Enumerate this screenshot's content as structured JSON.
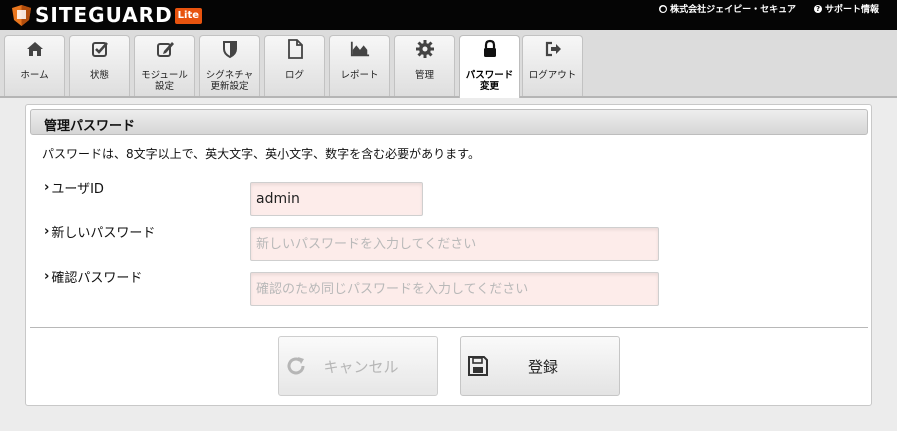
{
  "header": {
    "logo_text": "SITEGUARD",
    "logo_badge": "Lite",
    "links": [
      {
        "icon": "globe-icon",
        "label": "株式会社ジェイピー・セキュア"
      },
      {
        "icon": "question-icon",
        "label": "サポート情報"
      }
    ]
  },
  "tabs": [
    {
      "icon": "home-icon",
      "label": "ホーム",
      "active": false
    },
    {
      "icon": "checkbox-icon",
      "label": "状態",
      "active": false
    },
    {
      "icon": "edit-icon",
      "label": "モジュール\n設定",
      "active": false
    },
    {
      "icon": "shield-icon",
      "label": "シグネチャ\n更新設定",
      "active": false
    },
    {
      "icon": "file-icon",
      "label": "ログ",
      "active": false
    },
    {
      "icon": "area-chart-icon",
      "label": "レポート",
      "active": false
    },
    {
      "icon": "gear-icon",
      "label": "管理",
      "active": false
    },
    {
      "icon": "lock-icon",
      "label": "パスワード\n変更",
      "active": true
    },
    {
      "icon": "logout-icon",
      "label": "ログアウト",
      "active": false
    }
  ],
  "panel": {
    "title": "管理パスワード",
    "description": "パスワードは、8文字以上で、英大文字、英小文字、数字を含む必要があります。",
    "fields": {
      "user_id": {
        "label": "ユーザID",
        "value": "admin"
      },
      "new_password": {
        "label": "新しいパスワード",
        "value": "",
        "placeholder": "新しいパスワードを入力してください"
      },
      "confirm_password": {
        "label": "確認パスワード",
        "value": "",
        "placeholder": "確認のため同じパスワードを入力してください"
      }
    },
    "buttons": {
      "cancel": "キャンセル",
      "save": "登録"
    }
  },
  "colors": {
    "header_bg": "#050505",
    "lite_badge": "#e8530e",
    "field_bg": "#fdecea",
    "logo_orange": "#e8761e"
  }
}
